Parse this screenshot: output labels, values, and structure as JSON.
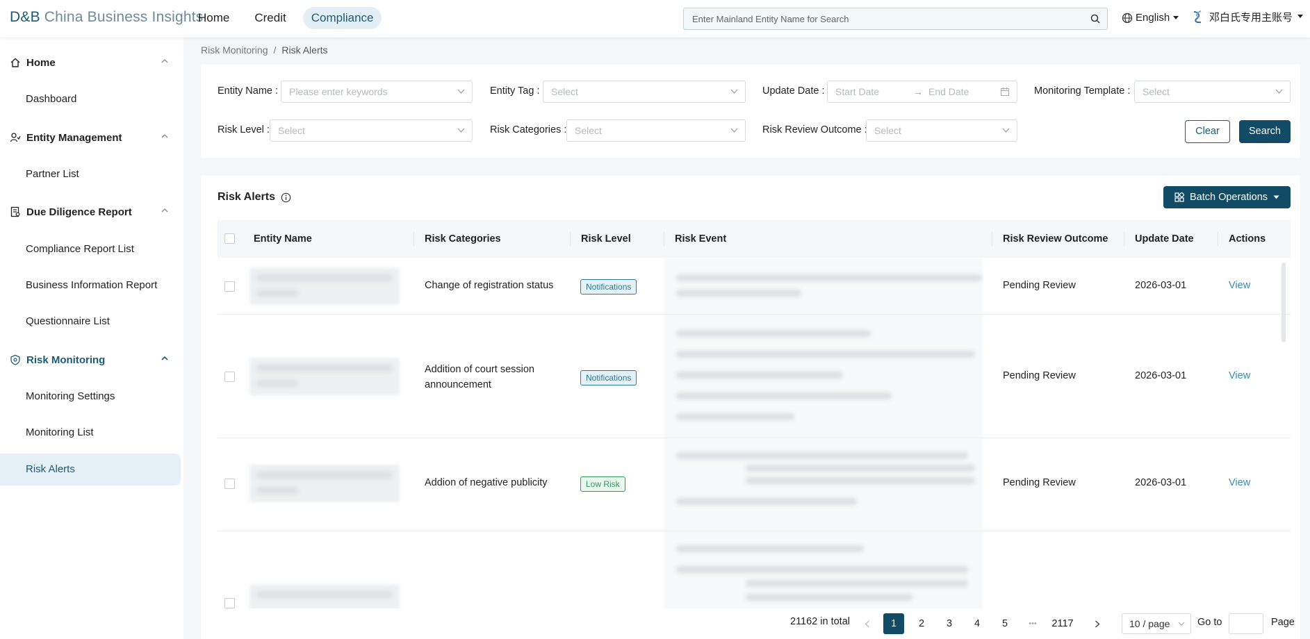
{
  "brand": {
    "logo": "D&B",
    "name": "China Business Insights"
  },
  "topnav": [
    "Home",
    "Credit",
    "Compliance"
  ],
  "search": {
    "placeholder": "Enter Mainland Entity Name for Search"
  },
  "language": "English",
  "account": "邓白氏专用主账号",
  "sidebar": {
    "home": {
      "label": "Home",
      "items": [
        "Dashboard"
      ]
    },
    "entity": {
      "label": "Entity Management",
      "items": [
        "Partner List"
      ]
    },
    "dd": {
      "label": "Due Diligence Report",
      "items": [
        "Compliance Report List",
        "Business Information Report",
        "Questionnaire List"
      ]
    },
    "risk": {
      "label": "Risk Monitoring",
      "items": [
        "Monitoring Settings",
        "Monitoring List",
        "Risk Alerts"
      ]
    }
  },
  "breadcrumb": {
    "parent": "Risk Monitoring",
    "sep": "/",
    "current": "Risk Alerts"
  },
  "filters": {
    "entity_name": {
      "label": "Entity Name :",
      "placeholder": "Please enter keywords"
    },
    "entity_tag": {
      "label": "Entity Tag :",
      "placeholder": "Select"
    },
    "update_date": {
      "label": "Update Date :",
      "start": "Start Date",
      "end": "End Date"
    },
    "template": {
      "label": "Monitoring Template :",
      "placeholder": "Select"
    },
    "risk_level": {
      "label": "Risk Level :",
      "placeholder": "Select"
    },
    "risk_categories": {
      "label": "Risk Categories :",
      "placeholder": "Select"
    },
    "review_outcome": {
      "label": "Risk Review Outcome :",
      "placeholder": "Select"
    },
    "clear": "Clear",
    "search": "Search"
  },
  "alerts": {
    "title": "Risk Alerts",
    "batch": "Batch Operations",
    "columns": [
      "Entity Name",
      "Risk Categories",
      "Risk Level",
      "Risk Event",
      "Risk Review Outcome",
      "Update Date",
      "Actions"
    ],
    "rows": [
      {
        "category": "Change of registration status",
        "level": "Notifications",
        "outcome": "Pending Review",
        "date": "2026-03-01",
        "action": "View"
      },
      {
        "category": "Addition of court session announcement",
        "level": "Notifications",
        "outcome": "Pending Review",
        "date": "2026-03-01",
        "action": "View"
      },
      {
        "category": "Addion of negative publicity",
        "level": "Low Risk",
        "outcome": "Pending Review",
        "date": "2026-03-01",
        "action": "View"
      }
    ]
  },
  "pagination": {
    "total": "21162 in total",
    "pages": [
      "1",
      "2",
      "3",
      "4",
      "5"
    ],
    "ellipsis": "•••",
    "last": "2117",
    "page_size": "10 / page",
    "goto": "Go to",
    "page": "Page"
  },
  "colors": {
    "primary": "#114b66",
    "accent": "#1d5a75",
    "link": "#3a8bb5"
  }
}
